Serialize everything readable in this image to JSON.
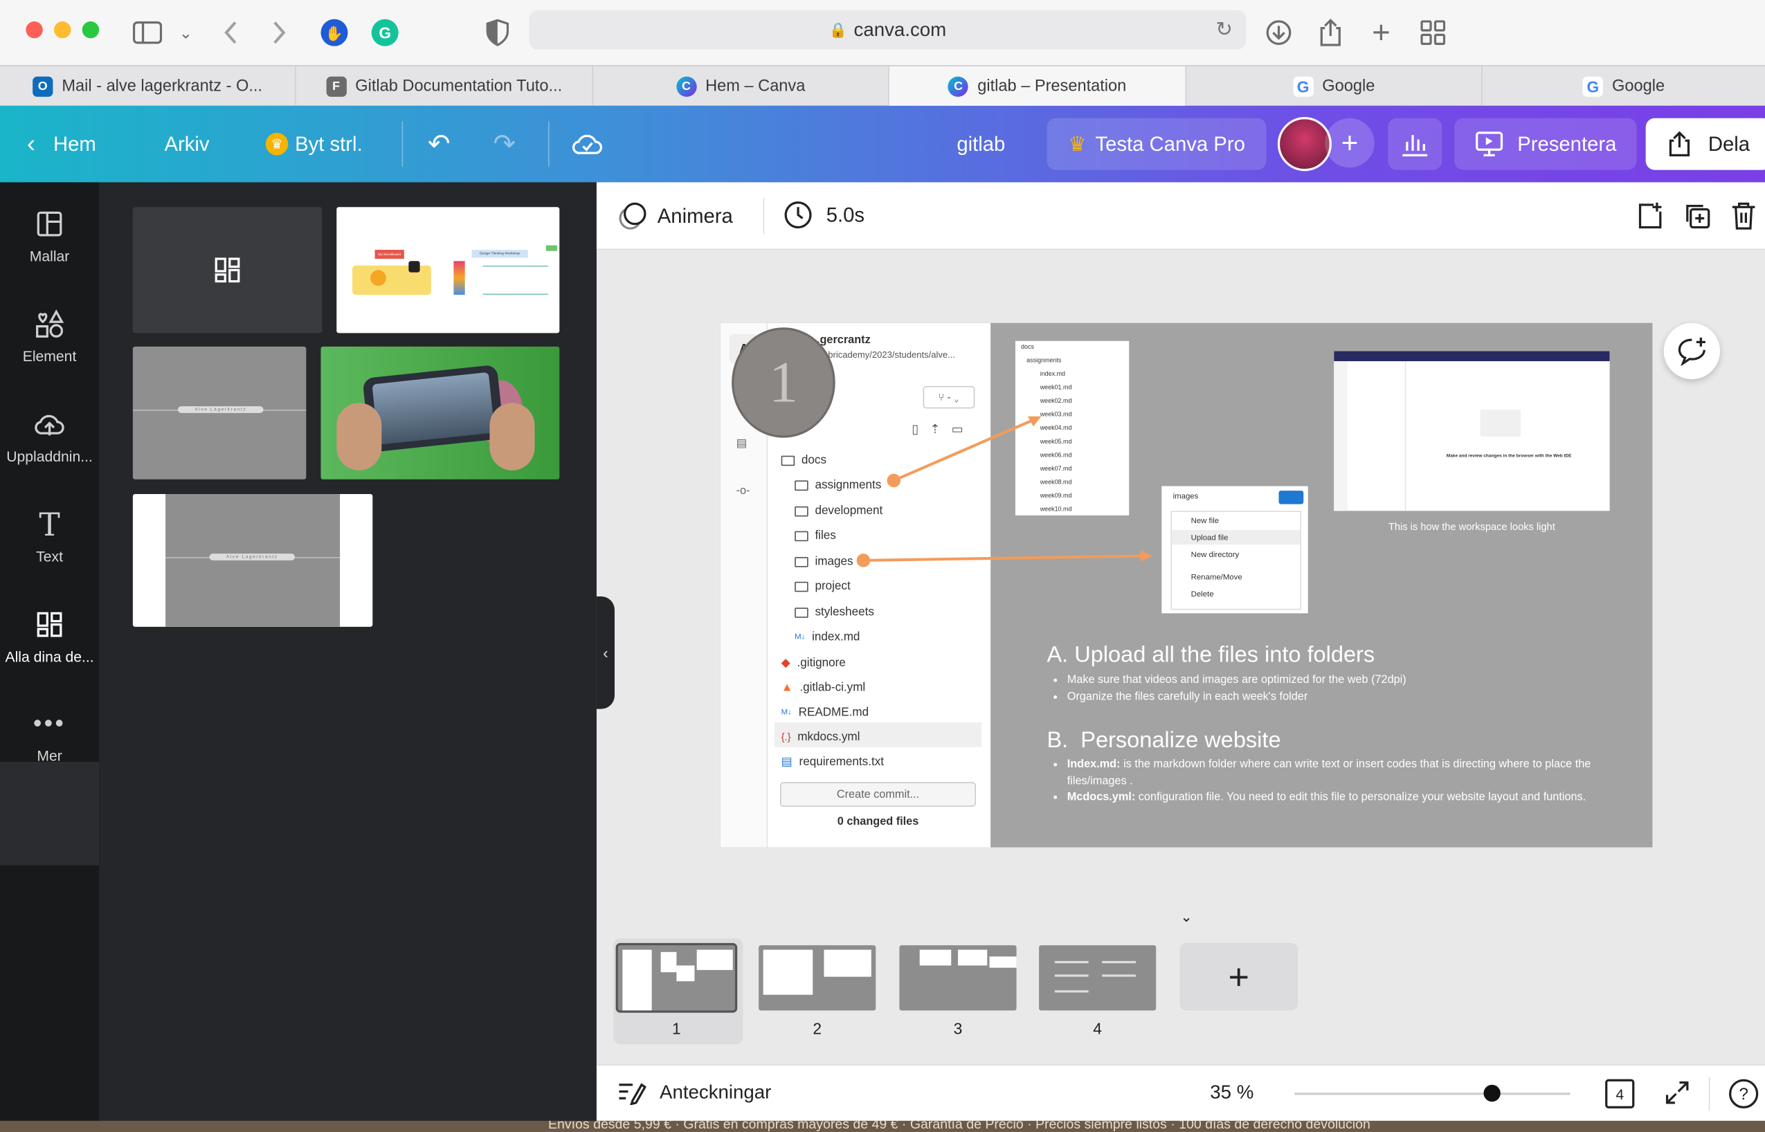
{
  "browser": {
    "url": "canva.com",
    "tabs": [
      {
        "label": "Mail - alve lagerkrantz - O...",
        "icon": "outlook-icon",
        "color": "#0f6cbd"
      },
      {
        "label": "Gitlab Documentation Tuto...",
        "icon": "f-icon",
        "color": "#6b6b6b"
      },
      {
        "label": "Hem – Canva",
        "icon": "canva-icon",
        "color": "#7d2ae8"
      },
      {
        "label": "gitlab – Presentation",
        "icon": "canva-icon",
        "color": "#7d2ae8"
      },
      {
        "label": "Google",
        "icon": "google-icon",
        "color": "#4285f4"
      },
      {
        "label": "Google",
        "icon": "google-icon",
        "color": "#4285f4"
      }
    ]
  },
  "topbar": {
    "home": "Hem",
    "file": "Arkiv",
    "resize": "Byt strl.",
    "title": "gitlab",
    "pro": "Testa Canva Pro",
    "present": "Presentera",
    "share": "Dela",
    "accent": "#7d2ae8"
  },
  "rail": [
    {
      "label": "Mallar",
      "icon": "templates-icon"
    },
    {
      "label": "Element",
      "icon": "elements-icon"
    },
    {
      "label": "Uppladdnin...",
      "icon": "upload-icon"
    },
    {
      "label": "Text",
      "icon": "text-icon"
    },
    {
      "label": "Alla dina de...",
      "icon": "all-designs-icon"
    },
    {
      "label": "Mer",
      "icon": "more-icon"
    }
  ],
  "panel": {
    "name_strip": "Alve Lagerkrantz",
    "mindmap_title": "My Moodboard",
    "mindmap_sub": "Design Thinking Workshop"
  },
  "context": {
    "animate": "Animera",
    "duration": "5.0s"
  },
  "slide": {
    "step_number": "1",
    "repo_name": "...gercrantz",
    "repo_path": ".../fabricademy/2023/students/alve...",
    "files": [
      "docs",
      "assignments",
      "development",
      "files",
      "images",
      "project",
      "stylesheets",
      "index.md",
      ".gitignore",
      ".gitlab-ci.yml",
      "README.md",
      "mkdocs.yml",
      "requirements.txt"
    ],
    "commit_btn": "Create commit...",
    "changed": "0 changed files",
    "docs_list": [
      "docs",
      "assignments",
      "index.md",
      "week01.md",
      "week02.md",
      "week03.md",
      "week04.md",
      "week05.md",
      "week06.md",
      "week07.md",
      "week08.md",
      "week09.md",
      "week10.md"
    ],
    "menu_folder": "images",
    "menu_items": [
      "New file",
      "Upload file",
      "New directory",
      "Rename/Move",
      "Delete"
    ],
    "ide_heading": "Make and review changes in the browser with the Web IDE",
    "ide_caption": "This is how the workspace looks light",
    "sectionA_title": "A. Upload all the files into folders",
    "sectionA_bullets": [
      "Make sure that videos and images are optimized for the web (72dpi)",
      "Organize the files carefully in each week's folder"
    ],
    "sectionB_title": "B.  Personalize website",
    "sectionB_b1_bold": "Index.md:",
    "sectionB_b1": " is the markdown folder where can write text or insert codes that is directing where to place the files/images .",
    "sectionB_b2_bold": "Mcdocs.yml:",
    "sectionB_b2": " configuration file. You need to edit this file to personalize your website layout and funtions."
  },
  "pages": [
    "1",
    "2",
    "3",
    "4"
  ],
  "footer": {
    "notes": "Anteckningar",
    "zoom": "35 %",
    "zoom_level": 0.35,
    "page_count": "4"
  },
  "bottom_ticker": "Envíos desde 5,99 € · Gratis en compras mayores de 49 € · Garantía de Precio · Precios siempre listos · 100 días de derecho devolución"
}
